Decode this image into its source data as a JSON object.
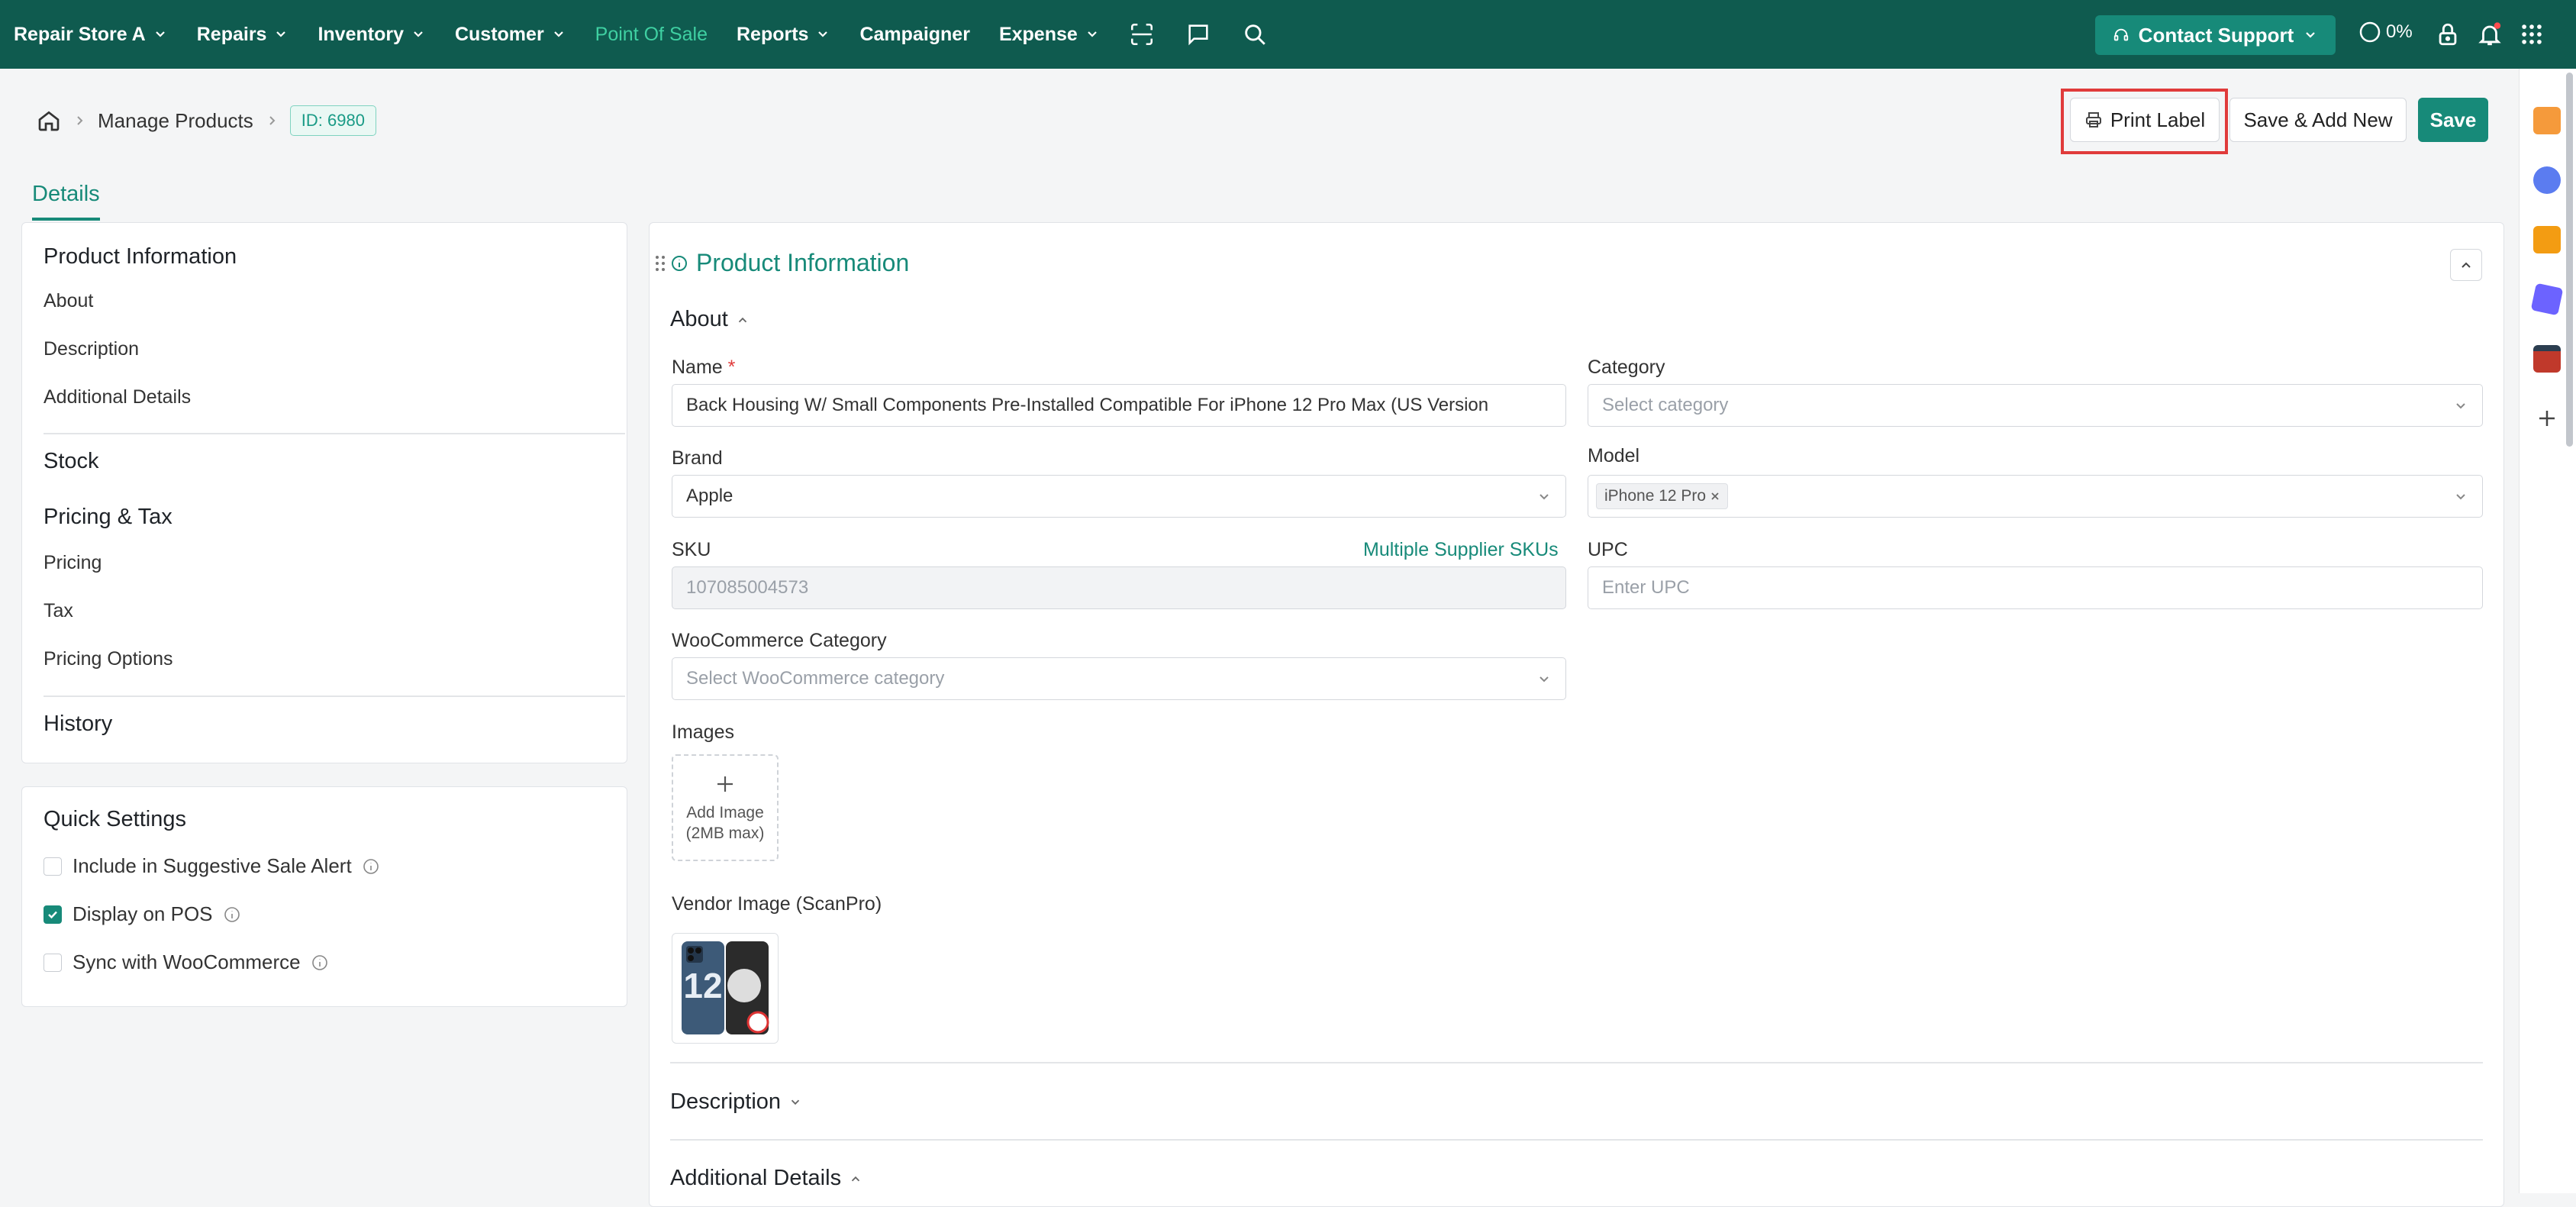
{
  "topnav": {
    "items": [
      {
        "label": "Repair Store A",
        "chevron": true
      },
      {
        "label": "Repairs",
        "chevron": true
      },
      {
        "label": "Inventory",
        "chevron": true
      },
      {
        "label": "Customer",
        "chevron": true
      },
      {
        "label": "Point Of Sale",
        "chevron": false,
        "active": true
      },
      {
        "label": "Reports",
        "chevron": true
      },
      {
        "label": "Campaigner",
        "chevron": false
      },
      {
        "label": "Expense",
        "chevron": true
      }
    ],
    "support_label": "Contact Support",
    "progress_text": "0%"
  },
  "breadcrumb": {
    "page": "Manage Products",
    "id_badge": "ID: 6980"
  },
  "actions": {
    "print_label": "Print Label",
    "save_add_new": "Save & Add New",
    "save": "Save"
  },
  "tabs": [
    "Details"
  ],
  "sidebar": {
    "groups": [
      {
        "heading": "Product Information",
        "items": [
          "About",
          "Description",
          "Additional Details"
        ]
      },
      {
        "heading": "Stock",
        "items": []
      },
      {
        "heading": "Pricing & Tax",
        "items": [
          "Pricing",
          "Tax",
          "Pricing Options"
        ]
      },
      {
        "heading": "History",
        "items": []
      }
    ]
  },
  "quick_settings": {
    "heading": "Quick Settings",
    "options": [
      {
        "label": "Include in Suggestive Sale Alert",
        "checked": false
      },
      {
        "label": "Display on POS",
        "checked": true
      },
      {
        "label": "Sync with WooCommerce",
        "checked": false
      }
    ]
  },
  "form": {
    "section_title": "Product Information",
    "about_heading": "About",
    "name_label": "Name",
    "name_required": "*",
    "name_value": "Back Housing W/ Small Components Pre-Installed Compatible For iPhone 12 Pro Max (US Version",
    "category_label": "Category",
    "category_placeholder": "Select category",
    "brand_label": "Brand",
    "brand_value": "Apple",
    "model_label": "Model",
    "model_tag": "iPhone 12 Pro",
    "sku_label": "SKU",
    "sku_link": "Multiple Supplier SKUs",
    "sku_value": "107085004573",
    "upc_label": "UPC",
    "upc_placeholder": "Enter UPC",
    "woo_label": "WooCommerce Category",
    "woo_placeholder": "Select WooCommerce category",
    "images_label": "Images",
    "add_image_line1": "Add Image",
    "add_image_line2": "(2MB max)",
    "vendor_image_label": "Vendor Image (ScanPro)",
    "vendor_image_text": "12",
    "description_heading": "Description",
    "additional_heading": "Additional Details"
  },
  "colors": {
    "nav_bg": "#0f5b4f",
    "accent": "#178a79",
    "active_nav": "#3fd0a2",
    "highlight": "#e03b3b"
  }
}
